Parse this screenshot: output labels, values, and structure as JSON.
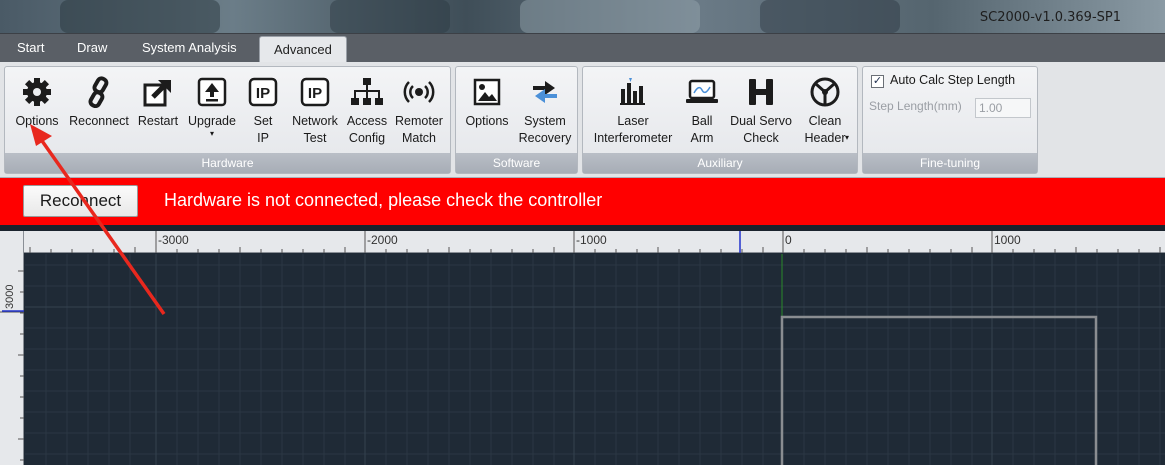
{
  "window": {
    "title": "SC2000-v1.0.369-SP1"
  },
  "tabs": [
    {
      "label": "Start"
    },
    {
      "label": "Draw"
    },
    {
      "label": "System Analysis"
    },
    {
      "label": "Advanced"
    }
  ],
  "ribbon": {
    "hardware": {
      "label": "Hardware",
      "buttons": [
        {
          "label": "Options",
          "icon": "gear-icon"
        },
        {
          "label": "Reconnect",
          "icon": "link-icon"
        },
        {
          "label": "Restart",
          "icon": "restart-arrow-icon"
        },
        {
          "label": "Upgrade",
          "icon": "upload-icon"
        },
        {
          "label": "Set\nIP",
          "icon": "ip-icon"
        },
        {
          "label": "Network\nTest",
          "icon": "ip-icon"
        },
        {
          "label": "Access\nConfig",
          "icon": "network-icon"
        },
        {
          "label": "Remoter\nMatch",
          "icon": "wireless-icon"
        }
      ]
    },
    "software": {
      "label": "Software",
      "buttons": [
        {
          "label": "Options",
          "icon": "picture-icon"
        },
        {
          "label": "System\nRecovery",
          "icon": "recovery-arrows-icon"
        }
      ]
    },
    "auxiliary": {
      "label": "Auxiliary",
      "buttons": [
        {
          "label": "Laser\nInterferometer",
          "icon": "interferometer-icon"
        },
        {
          "label": "Ball\nArm",
          "icon": "laptop-icon"
        },
        {
          "label": "Dual Servo\nCheck",
          "icon": "dual-servo-icon"
        },
        {
          "label": "Clean\nHeader",
          "icon": "clean-header-icon"
        }
      ]
    },
    "finetuning": {
      "label": "Fine-tuning",
      "auto_calc_label": "Auto Calc Step Length",
      "auto_calc_checked": true,
      "step_length_label": "Step Length(mm)",
      "step_length_value": "1.00"
    }
  },
  "alert": {
    "button_label": "Reconnect",
    "message": "Hardware is not connected, please check the controller",
    "color": "#ff0000"
  },
  "ruler": {
    "x_labels": [
      "-3000",
      "-2000",
      "-1000",
      "0",
      "1000"
    ],
    "y_labels": [
      "3000"
    ]
  }
}
